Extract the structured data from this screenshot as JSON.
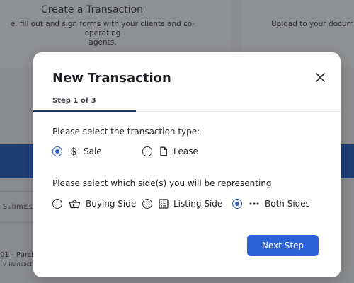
{
  "background": {
    "left_card": {
      "title": "Create a Transaction",
      "subtitle_line1": "e, fill out and sign forms with your clients and co-operating",
      "subtitle_line2": "agents."
    },
    "right_card": {
      "subtitle": "Upload to your documen"
    },
    "table": {
      "column_label": "Submissio",
      "row_title": "01 - Purch",
      "row_subtitle": "v Transaction"
    }
  },
  "modal": {
    "title": "New Transaction",
    "step": "Step 1 of 3",
    "step_progress": 0.333,
    "transaction_type": {
      "question": "Please select the transaction type:",
      "options": [
        {
          "label": "Sale",
          "icon": "dollar-icon",
          "selected": true
        },
        {
          "label": "Lease",
          "icon": "document-icon",
          "selected": false
        }
      ]
    },
    "representing": {
      "question": "Please select which side(s) you will be representing",
      "options": [
        {
          "label": "Buying Side",
          "icon": "basket-icon",
          "selected": false
        },
        {
          "label": "Listing Side",
          "icon": "list-icon",
          "selected": false
        },
        {
          "label": "Both Sides",
          "icon": "ellipsis-icon",
          "selected": true
        }
      ]
    },
    "next_button": "Next Step"
  },
  "colors": {
    "accent": "#2d62d6",
    "step_bar": "#1e3564",
    "background_band": "#1e3d73"
  }
}
